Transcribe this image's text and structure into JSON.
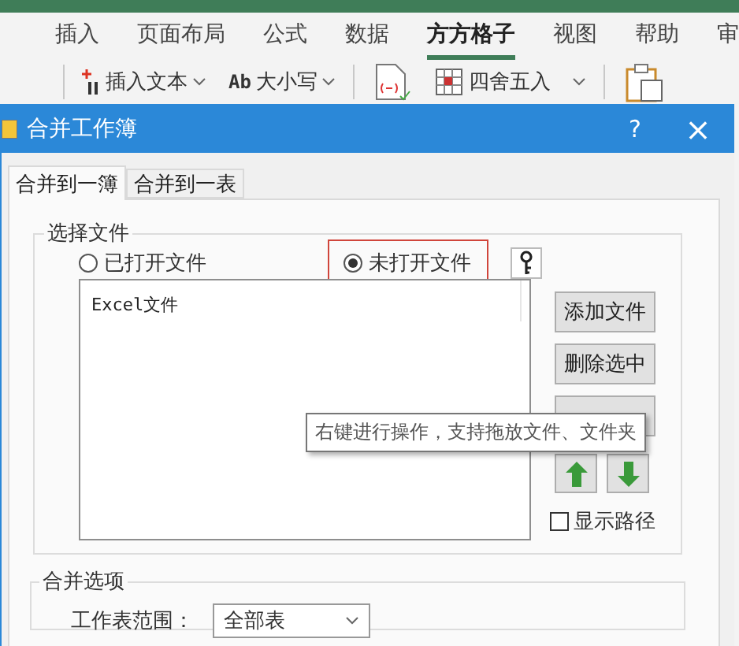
{
  "ribbon": {
    "tabs": [
      {
        "label": "插入",
        "selected": false
      },
      {
        "label": "页面布局",
        "selected": false
      },
      {
        "label": "公式",
        "selected": false
      },
      {
        "label": "数据",
        "selected": false
      },
      {
        "label": "方方格子",
        "selected": true
      },
      {
        "label": "视图",
        "selected": false
      },
      {
        "label": "帮助",
        "selected": false
      },
      {
        "label": "审",
        "selected": false
      }
    ],
    "tools": [
      {
        "kind": "insert",
        "label": "插入文本"
      },
      {
        "kind": "case",
        "badge": "Ab",
        "label": "大小写"
      },
      {
        "kind": "doc"
      },
      {
        "kind": "round",
        "label": "四舍五入"
      },
      {
        "kind": "clipboard"
      }
    ]
  },
  "dialog": {
    "title": "合并工作簿",
    "help": "?",
    "close": "×",
    "tabs": [
      {
        "label": "合并到一簿",
        "selected": true
      },
      {
        "label": "合并到一表",
        "selected": false
      }
    ],
    "file_group": {
      "legend": "选择文件",
      "options": [
        {
          "label": "已打开文件",
          "selected": false
        },
        {
          "label": "未打开文件",
          "selected": true
        }
      ],
      "list_header": "Excel文件",
      "buttons": [
        "添加文件",
        "删除选中"
      ],
      "tooltip": "右键进行操作，支持拖放文件、文件夹",
      "show_path": {
        "label": "显示路径",
        "checked": false
      }
    },
    "options_group": {
      "legend": "合并选项",
      "range_label": "工作表范围：",
      "range_value": "全部表"
    }
  }
}
